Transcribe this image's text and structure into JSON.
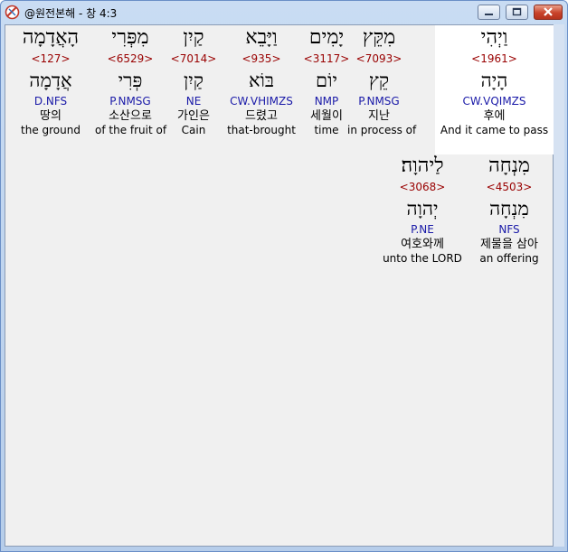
{
  "window": {
    "title": "@원전본해 - 창 4:3"
  },
  "rows": [
    {
      "words": [
        {
          "hebrew": "וַיְהִי",
          "strong": "<1961>",
          "lemma": "הָיָה",
          "morph": "CW.VQIMZS",
          "korean": "후에",
          "english": "And it came to pass",
          "highlight": true
        },
        {
          "hebrew": "מִקֵּץ",
          "strong": "<7093>",
          "lemma": "קֵץ",
          "morph": "P.NMSG",
          "korean": "지난",
          "english": "in process of"
        },
        {
          "hebrew": "יָמִים",
          "strong": "<3117>",
          "lemma": "יוֹם",
          "morph": "NMP",
          "korean": "세월이",
          "english": "time"
        },
        {
          "hebrew": "וַיָּבֵא",
          "strong": "<935>",
          "lemma": "בּוֹא",
          "morph": "CW.VHIMZS",
          "korean": "드렸고",
          "english": "that-brought"
        },
        {
          "hebrew": "קַיִן",
          "strong": "<7014>",
          "lemma": "קַיִן",
          "morph": "NE",
          "korean": "가인은",
          "english": "Cain"
        },
        {
          "hebrew": "מִפְּרִי",
          "strong": "<6529>",
          "lemma": "פְּרִי",
          "morph": "P.NMSG",
          "korean": "소산으로",
          "english": "of the fruit of"
        },
        {
          "hebrew": "הָאֲדָמָה",
          "strong": "<127>",
          "lemma": "אֲדָמָה",
          "morph": "D.NFS",
          "korean": "땅의",
          "english": "the ground"
        }
      ]
    },
    {
      "words": [
        {
          "hebrew": "מִנְחָה",
          "strong": "<4503>",
          "lemma": "מִנְחָה",
          "morph": "NFS",
          "korean": "제물을 삼아",
          "english": "an offering"
        },
        {
          "hebrew": "לַיהוָה׃",
          "strong": "<3068>",
          "lemma": "יְהוָה",
          "morph": "P.NE",
          "korean": "여호와께",
          "english": "unto the LORD"
        }
      ]
    }
  ]
}
